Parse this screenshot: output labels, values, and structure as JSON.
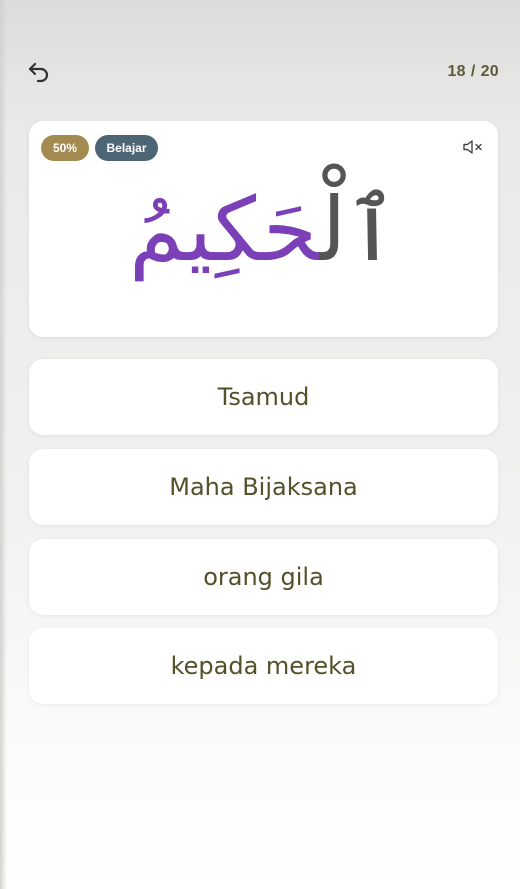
{
  "header": {
    "back_icon": "undo-arrow-icon",
    "progress_current": "18",
    "progress_separator": "/",
    "progress_total": "20"
  },
  "word_card": {
    "percent_badge": "50%",
    "mode_badge": "Belajar",
    "mute_icon": "speaker-muted-icon",
    "arabic_prefix": "ٱلْ",
    "arabic_stem": "حَكِيمُ",
    "colors": {
      "stem": "#7b3fb7",
      "prefix": "#555555",
      "percent_badge_bg": "#a38b4f",
      "mode_badge_bg": "#4d6675"
    }
  },
  "options": [
    {
      "label": "Tsamud"
    },
    {
      "label": "Maha Bijaksana"
    },
    {
      "label": "orang gila"
    },
    {
      "label": "kepada mereka"
    }
  ]
}
